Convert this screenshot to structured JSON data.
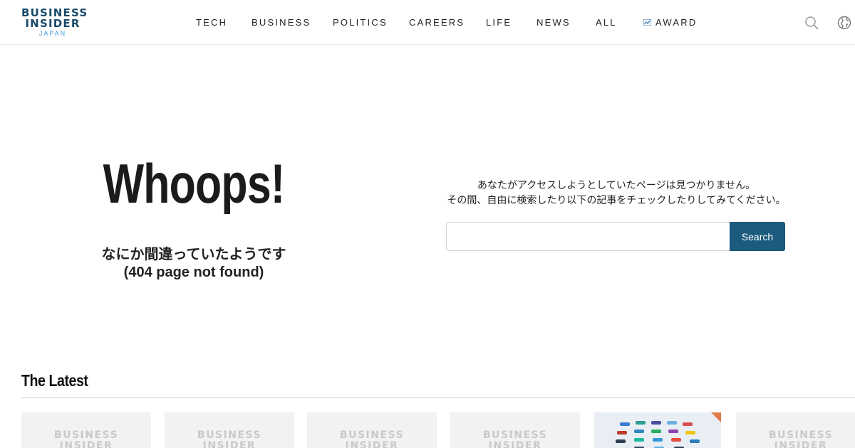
{
  "brand": {
    "line1": "BUSINESS",
    "line2": "INSIDER",
    "line3": "JAPAN"
  },
  "nav": {
    "items": [
      {
        "label": "TECH"
      },
      {
        "label": "BUSINESS"
      },
      {
        "label": "POLITICS"
      },
      {
        "label": "CAREERS"
      },
      {
        "label": "LIFE"
      },
      {
        "label": "NEWS"
      },
      {
        "label": "ALL"
      },
      {
        "label": "AWARD",
        "icon": "award-chart-icon"
      }
    ]
  },
  "header_icons": [
    "search-icon",
    "globe-icon"
  ],
  "error": {
    "title": "Whoops!",
    "subtitle": "なにか間違っていたようです",
    "code": "(404 page not found)"
  },
  "message": {
    "line1": "あなたがアクセスしようとしていたページは見つかりません。",
    "line2": "その間、自由に検索したり以下の記事をチェックしたりしてみてください。"
  },
  "search": {
    "value": "",
    "placeholder": "",
    "button_label": "Search"
  },
  "latest": {
    "heading": "The Latest",
    "placeholder_line1": "BUSINESS",
    "placeholder_line2": "INSIDER"
  },
  "colors": {
    "brand_dark": "#1a4a6b",
    "brand_light": "#3b9fd8",
    "button": "#1a5b7e",
    "accent_corner": "#e07a4a"
  }
}
